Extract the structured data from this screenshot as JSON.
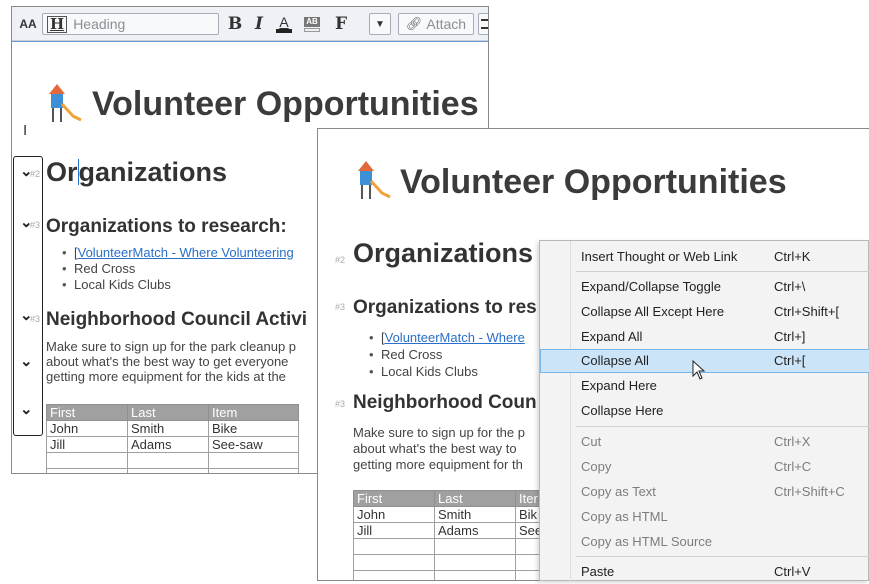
{
  "toolbar": {
    "font_size_label": "AA",
    "heading_style_label": "Heading",
    "bold_label": "B",
    "italic_label": "I",
    "color_label": "A",
    "highlight_label": "AB",
    "font_label": "F",
    "attach_label": "Attach"
  },
  "doc": {
    "title": "Volunteer Opportunities",
    "h2_text_before_cursor": "Or",
    "h2_text_after_cursor": "ganizations",
    "h2": "Organizations",
    "h2_level": "#2",
    "h3_research": "Organizations to research:",
    "h3_research_short": "Organizations to res",
    "h3_level": "#3",
    "bullet_link": "VolunteerMatch - Where Volunteering",
    "bullet_link_short": "VolunteerMatch - Where",
    "bullet_2": "Red Cross",
    "bullet_3": "Local Kids Clubs",
    "h3_council": "Neighborhood Council Activi",
    "h3_council_short": "Neighborhood Coun",
    "para_line1": "Make sure to sign up for the park cleanup p",
    "para_line1_short": "Make sure to sign up for the p",
    "para_line2": "about what's the best way to get everyone",
    "para_line2_short": "about what's the best way to",
    "para_line3": "getting more equipment for the kids at the",
    "para_line3_short": "getting more equipment for th",
    "table": {
      "headers": [
        "First",
        "Last",
        "Item"
      ],
      "rows": [
        [
          "John",
          "Smith",
          "Bike"
        ],
        [
          "Jill",
          "Adams",
          "See-saw"
        ]
      ],
      "front_headers": [
        "First",
        "Last",
        "Iter"
      ],
      "front_rows": [
        [
          "John",
          "Smith",
          "Bik"
        ],
        [
          "Jill",
          "Adams",
          "See"
        ]
      ]
    }
  },
  "context_menu": {
    "items": [
      {
        "label": "Insert Thought or Web Link",
        "shortcut": "Ctrl+K"
      },
      {
        "label": "Expand/Collapse Toggle",
        "shortcut": "Ctrl+\\"
      },
      {
        "label": "Collapse All Except Here",
        "shortcut": "Ctrl+Shift+["
      },
      {
        "label": "Expand All",
        "shortcut": "Ctrl+]"
      },
      {
        "label": "Collapse All",
        "shortcut": "Ctrl+["
      },
      {
        "label": "Expand Here",
        "shortcut": ""
      },
      {
        "label": "Collapse Here",
        "shortcut": ""
      },
      {
        "label": "Cut",
        "shortcut": "Ctrl+X"
      },
      {
        "label": "Copy",
        "shortcut": "Ctrl+C"
      },
      {
        "label": "Copy as Text",
        "shortcut": "Ctrl+Shift+C"
      },
      {
        "label": "Copy as HTML",
        "shortcut": ""
      },
      {
        "label": "Copy as HTML Source",
        "shortcut": ""
      },
      {
        "label": "Paste",
        "shortcut": "Ctrl+V"
      }
    ],
    "highlighted_item": "Collapse All"
  },
  "colors": {
    "link": "#2a6fc9",
    "menu_highlight": "#cce4f7",
    "table_header": "#a0a0a0"
  }
}
